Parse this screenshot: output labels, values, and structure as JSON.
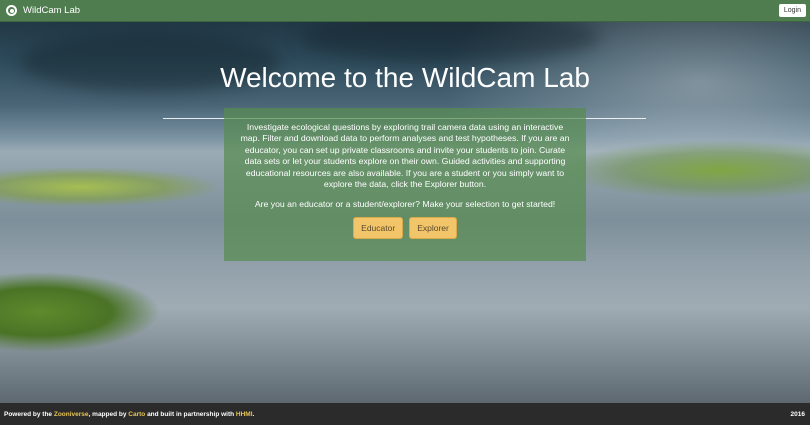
{
  "header": {
    "brand": "WildCam Lab",
    "login_label": "Login",
    "bg_color": "#4f7d50"
  },
  "hero": {
    "title": "Welcome to the WildCam Lab",
    "description": "Investigate ecological questions by exploring trail camera data using an interactive map. Filter and download data to perform analyses and test hypotheses. If you are an educator, you can set up private classrooms and invite your students to join. Curate data sets or let your students explore on their own. Guided activities and supporting educational resources are also available. If you are a student or you simply want to explore the data, click the Explorer button.",
    "prompt": "Are you an educator or a student/explorer? Make your selection to get started!",
    "educator_label": "Educator",
    "explorer_label": "Explorer",
    "button_color": "#f3c56b"
  },
  "footer": {
    "powered_by": "Powered by the ",
    "zooniverse": "Zooniverse",
    "mapped_by": ", mapped by ",
    "carto": "Carto",
    "built_with": " and built in partnership with ",
    "hhmi": "HHMI",
    "period": ".",
    "year": "2016",
    "link_color": "#e8c456"
  }
}
